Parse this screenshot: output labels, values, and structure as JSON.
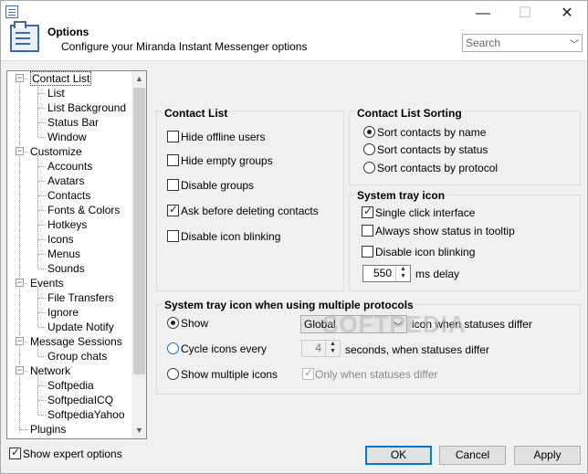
{
  "window": {
    "close_glyph": "✕",
    "minimize_glyph": "—",
    "maximize_glyph": "☐"
  },
  "header": {
    "title": "Options",
    "subtitle": "Configure your Miranda Instant Messenger options",
    "search_placeholder": "Search"
  },
  "tree": {
    "items": [
      {
        "label": "Contact List",
        "level": 0,
        "expanded": true,
        "selected": true
      },
      {
        "label": "List",
        "level": 1
      },
      {
        "label": "List Background",
        "level": 1
      },
      {
        "label": "Status Bar",
        "level": 1
      },
      {
        "label": "Window",
        "level": 1
      },
      {
        "label": "Customize",
        "level": 0,
        "expanded": true
      },
      {
        "label": "Accounts",
        "level": 1
      },
      {
        "label": "Avatars",
        "level": 1
      },
      {
        "label": "Contacts",
        "level": 1
      },
      {
        "label": "Fonts & Colors",
        "level": 1
      },
      {
        "label": "Hotkeys",
        "level": 1
      },
      {
        "label": "Icons",
        "level": 1
      },
      {
        "label": "Menus",
        "level": 1
      },
      {
        "label": "Sounds",
        "level": 1
      },
      {
        "label": "Events",
        "level": 0,
        "expanded": true
      },
      {
        "label": "File Transfers",
        "level": 1
      },
      {
        "label": "Ignore",
        "level": 1
      },
      {
        "label": "Update Notify",
        "level": 1
      },
      {
        "label": "Message Sessions",
        "level": 0,
        "expanded": true
      },
      {
        "label": "Group chats",
        "level": 1
      },
      {
        "label": "Network",
        "level": 0,
        "expanded": true
      },
      {
        "label": "Softpedia",
        "level": 1
      },
      {
        "label": "SoftpediaICQ",
        "level": 1
      },
      {
        "label": "SoftpediaYahoo",
        "level": 1
      },
      {
        "label": "Plugins",
        "level": 0
      }
    ]
  },
  "contact_list": {
    "title": "Contact List",
    "options": [
      {
        "label": "Hide offline users",
        "checked": false
      },
      {
        "label": "Hide empty groups",
        "checked": false
      },
      {
        "label": "Disable groups",
        "checked": false
      },
      {
        "label": "Ask before deleting contacts",
        "checked": true
      },
      {
        "label": "Disable icon blinking",
        "checked": false
      }
    ]
  },
  "sorting": {
    "title": "Contact List Sorting",
    "options": [
      {
        "label": "Sort contacts by name",
        "selected": true
      },
      {
        "label": "Sort contacts by status",
        "selected": false
      },
      {
        "label": "Sort contacts by protocol",
        "selected": false
      }
    ]
  },
  "tray": {
    "title": "System tray icon",
    "single_click": {
      "label": "Single click interface",
      "checked": true
    },
    "always_status": {
      "label": "Always show status in tooltip",
      "checked": false
    },
    "disable_blink": {
      "label": "Disable icon blinking",
      "checked": false
    },
    "delay_value": "550",
    "delay_unit": "ms delay"
  },
  "multi": {
    "title": "System tray icon when using multiple protocols",
    "show": {
      "label": "Show",
      "selected": true
    },
    "show_combo": "Global",
    "show_suffix": "icon when statuses differ",
    "cycle": {
      "label": "Cycle icons every",
      "selected": false
    },
    "cycle_value": "4",
    "cycle_suffix": "seconds, when statuses differ",
    "multiple": {
      "label": "Show multiple icons",
      "selected": false
    },
    "only_when": {
      "label": "Only when statuses differ",
      "checked": true
    }
  },
  "watermark": "SOFTPEDIA",
  "footer": {
    "expert": {
      "label": "Show expert options",
      "checked": true
    },
    "ok": "OK",
    "cancel": "Cancel",
    "apply": "Apply"
  }
}
